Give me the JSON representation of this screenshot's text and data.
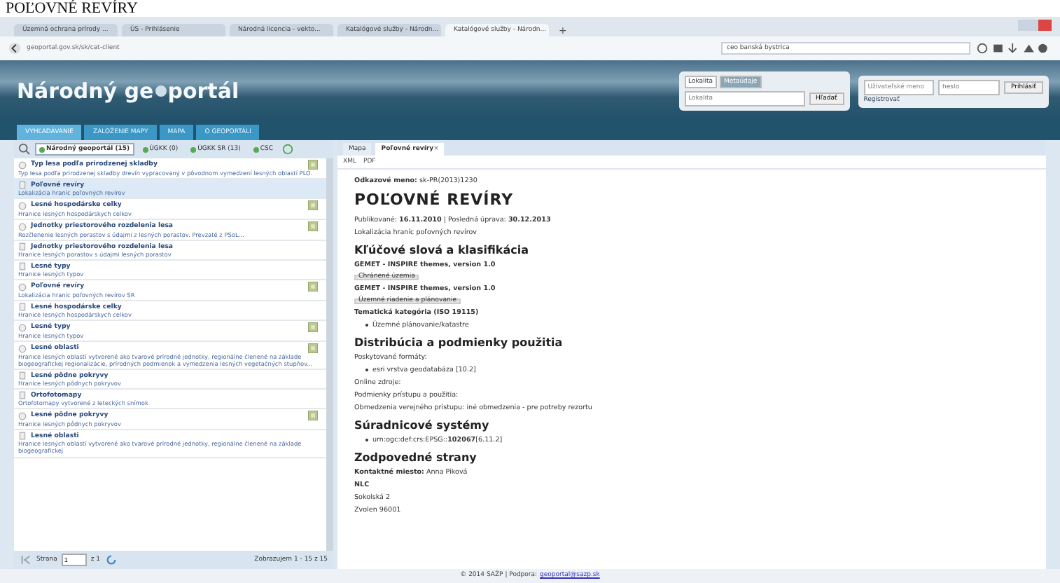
{
  "caption": "POĽOVNÉ REVÍRY",
  "browser": {
    "tabs": [
      {
        "label": "Územná ochrana prírody ...",
        "selected": false
      },
      {
        "label": "ÚS - Prihlásenie",
        "selected": false
      },
      {
        "label": "Národná licencia - vekto...",
        "selected": false
      },
      {
        "label": "Katalógové služby - Národn...",
        "selected": false
      },
      {
        "label": "Katalógové služby - Národn...",
        "selected": true
      }
    ],
    "new_tab": "+",
    "address": "geoportal.gov.sk/sk/cat-client",
    "search": "ceo banská bystrica"
  },
  "header": {
    "logo_part1": "Národný ge",
    "logo_part2": "portál",
    "search_tabs": [
      {
        "label": "Lokalita",
        "selected": false
      },
      {
        "label": "Metaúdaje",
        "selected": true
      }
    ],
    "search_placeholder": "Lokalita",
    "search_button": "Hľadať",
    "username_placeholder": "Užívateľské meno",
    "password_placeholder": "heslo",
    "login_button": "Prihlásiť",
    "register_link": "Registrovať"
  },
  "nav": [
    {
      "label": "VYHĽADÁVANIE",
      "selected": true
    },
    {
      "label": "ZALOŽENIE MAPY",
      "selected": false
    },
    {
      "label": "MAPA",
      "selected": false
    },
    {
      "label": "O GEOPORTÁLI",
      "selected": false
    }
  ],
  "sources": [
    {
      "label": "Národný geoportál (15)",
      "selected": true
    },
    {
      "label": "ÚGKK (0)",
      "selected": false
    },
    {
      "label": "ÚGKK SR (13)",
      "selected": false
    },
    {
      "label": "CSC",
      "selected": false
    }
  ],
  "results": [
    {
      "title": "Typ lesa podľa prirodzenej skladby",
      "description": "Typ lesa podľa prirodzenej skladby drevín vypracovaný v pôvodnom vymedzení lesných oblastí PLO.",
      "kind": "service",
      "preview": true,
      "selected": false
    },
    {
      "title": "Poľovné revíry",
      "description": "Lokalizácia hraníc poľovných revírov",
      "kind": "dataset",
      "preview": false,
      "selected": true
    },
    {
      "title": "Lesné hospodárske celky",
      "description": "Hranice lesných hospodárskych celkov",
      "kind": "service",
      "preview": true,
      "selected": false
    },
    {
      "title": "Jednotky priestorového rozdelenia lesa",
      "description": "Rozčlenenie lesných porastov s údajmi z lesných porastov. Prevzaté z PSoL...",
      "kind": "service",
      "preview": true,
      "selected": false
    },
    {
      "title": "Jednotky priestorového rozdelenia lesa",
      "description": "Hranice lesných porastov s údajmi lesných porastov",
      "kind": "dataset",
      "preview": false,
      "selected": false
    },
    {
      "title": "Lesné typy",
      "description": "Hranice lesných typov",
      "kind": "dataset",
      "preview": false,
      "selected": false
    },
    {
      "title": "Poľovné revíry",
      "description": "Lokalizácia hraníc poľovných revírov SR",
      "kind": "service",
      "preview": true,
      "selected": false
    },
    {
      "title": "Lesné hospodárske celky",
      "description": "Hranice lesných hospodárskych celkov",
      "kind": "dataset",
      "preview": false,
      "selected": false
    },
    {
      "title": "Lesné typy",
      "description": "Hranice lesných typov",
      "kind": "service",
      "preview": true,
      "selected": false
    },
    {
      "title": "Lesné oblasti",
      "description": "Hranice lesných oblastí vytvorené ako tvarové prírodné jednotky, regionálne členené na základe biogeografickej regionalizácie, prírodných podmienok a vymedzenia lesných vegetačných stupňov...",
      "kind": "service",
      "preview": true,
      "selected": false
    },
    {
      "title": "Lesné pôdne pokryvy",
      "description": "Hranice lesných pôdnych pokryvov",
      "kind": "dataset",
      "preview": false,
      "selected": false
    },
    {
      "title": "Ortofotomapy",
      "description": "Ortofotomapy vytvorené z leteckých snímok",
      "kind": "dataset",
      "preview": false,
      "selected": false
    },
    {
      "title": "Lesné pôdne pokryvy",
      "description": "Hranice lesných pôdnych pokryvov",
      "kind": "service",
      "preview": true,
      "selected": false
    },
    {
      "title": "Lesné oblasti",
      "description": "Hranice lesných oblastí vytvorené ako tvarové prírodné jednotky, regionálne členené na základe biogeografickej",
      "kind": "dataset",
      "preview": false,
      "selected": false
    }
  ],
  "pager": {
    "page_label": "Strana",
    "page": "1",
    "of": "z 1",
    "summary": "Zobrazujem 1 - 15 z 15"
  },
  "detail_tabs": [
    {
      "label": "Mapa",
      "selected": false
    },
    {
      "label": "Poľovné revíry",
      "selected": true
    }
  ],
  "detail_tab_close": "×",
  "exports": [
    "XML",
    "PDF"
  ],
  "detail": {
    "identifier": "**Odkazové meno:** sk-PR(2013)1230",
    "title": "POĽOVNÉ REVÍRY",
    "dates": "Publikované: **16.11.2010** | Posledná úprava: **30.12.2013**",
    "abstract": "Lokalizácia hraníc poľovných revírov",
    "sections": [
      {
        "heading": "Kľúčové slová a klasifikácia",
        "blocks": [
          {
            "kind": "bold",
            "text": "GEMET - INSPIRE themes, version 1.0"
          },
          {
            "kind": "tag",
            "text": "Chránené územia"
          },
          {
            "kind": "bold",
            "text": "GEMET - INSPIRE themes, version 1.0"
          },
          {
            "kind": "tag",
            "text": "Územné riadenie a plánovanie"
          },
          {
            "kind": "bold",
            "text": "Tematická kategória (ISO 19115)"
          },
          {
            "kind": "bullet",
            "text": "Územné plánovanie/katastre"
          }
        ]
      },
      {
        "heading": "Distribúcia a podmienky použitia",
        "blocks": [
          {
            "kind": "plain",
            "text": "Poskytované formáty:"
          },
          {
            "kind": "bullet",
            "text": "esri vrstva geodatabáza [10.2]"
          },
          {
            "kind": "plain",
            "text": "Online zdroje:"
          },
          {
            "kind": "plain",
            "text": "Podmienky prístupu a použitia:"
          },
          {
            "kind": "plain",
            "text": "Obmedzenia verejného prístupu: iné obmedzenia - pre potreby rezortu"
          }
        ]
      },
      {
        "heading": "Súradnicové systémy",
        "blocks": [
          {
            "kind": "bullet",
            "text": "urn:ogc:def:crs:EPSG::**102067**[6.11.2]"
          }
        ]
      },
      {
        "heading": "Zodpovedné strany",
        "blocks": [
          {
            "kind": "plain",
            "text": "**Kontaktné miesto:** Anna Piková"
          },
          {
            "kind": "bold",
            "text": "NLC"
          },
          {
            "kind": "plain",
            "text": "Sokolská 2"
          },
          {
            "kind": "plain",
            "text": "Zvolen 96001"
          }
        ]
      }
    ]
  },
  "footer": {
    "text": "© 2014 SAŽP | Podpora:",
    "link": "geoportal@sazp.sk"
  }
}
